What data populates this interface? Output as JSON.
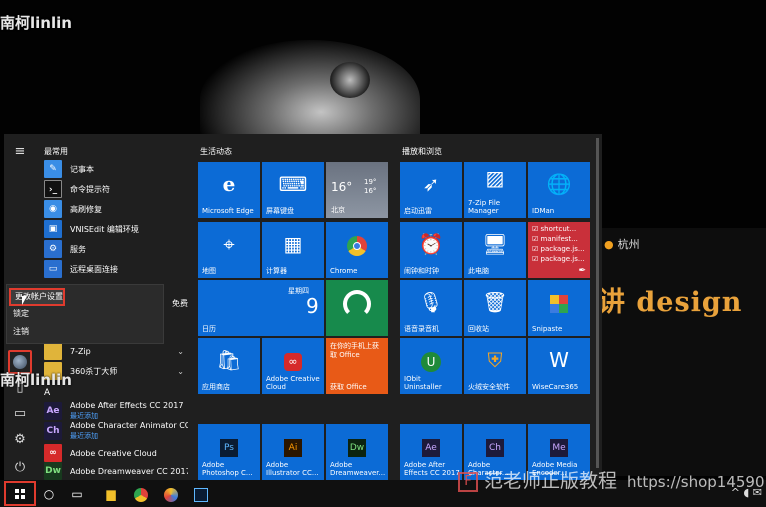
{
  "watermarks": {
    "top_left": "南柯linlin",
    "mid_left": "南柯linlin",
    "bottom_right": "范老师正版教程",
    "bottom_right_url": "https://shop14590"
  },
  "background_window": {
    "city": "杭州",
    "design_text": "讲 design"
  },
  "start_menu": {
    "section_recent": "最常用",
    "recent_apps": [
      {
        "name": "记事本"
      },
      {
        "name": "命令提示符"
      },
      {
        "name": "高刷修复"
      },
      {
        "name": "VNISEdit 编辑环境"
      },
      {
        "name": "服务"
      },
      {
        "name": "远程桌面连接"
      }
    ],
    "partial_text": "免费",
    "folders": [
      {
        "name": "7-Zip"
      },
      {
        "name": "360杀丁大师"
      }
    ],
    "letter_a": "A",
    "a_apps": [
      {
        "name": "Adobe After Effects CC 2017",
        "sub": "最近添加"
      },
      {
        "name": "Adobe Character Animator CC (...",
        "sub": "最近添加"
      },
      {
        "name": "Adobe Creative Cloud",
        "sub": ""
      },
      {
        "name": "Adobe Dreamweaver CC 2017",
        "sub": ""
      }
    ],
    "context_menu": {
      "change_account": "更改帐户设置",
      "lock": "锁定",
      "sign_out": "注销"
    },
    "groups": {
      "life": "生活动态",
      "play": "播放和浏览"
    },
    "weather": {
      "temp": "16°",
      "high": "19°",
      "low": "16°",
      "city": "北京"
    },
    "calendar": {
      "weekday": "星期四",
      "day": "9",
      "label": "日历"
    },
    "office_promo": {
      "text": "在你的手机上获取 Office",
      "label": "获取 Office"
    },
    "tiles_life": [
      {
        "label": "Microsoft Edge"
      },
      {
        "label": "屏幕键盘"
      },
      {
        "label": "地图"
      },
      {
        "label": "计算器"
      },
      {
        "label": "Chrome"
      },
      {
        "label": "应用商店"
      },
      {
        "label": "Adobe Creative Cloud"
      }
    ],
    "tiles_play": [
      {
        "label": "启动迅雷"
      },
      {
        "label": "7-Zip File Manager"
      },
      {
        "label": "IDMan"
      },
      {
        "label": "闹钟和时钟"
      },
      {
        "label": "此电脑"
      },
      {
        "label": "语音录音机"
      },
      {
        "label": "回收站"
      },
      {
        "label": "Snipaste"
      },
      {
        "label": "IObit Uninstaller"
      },
      {
        "label": "火绒安全软件"
      },
      {
        "label": "WiseCare365"
      }
    ],
    "shortcuts_tile": [
      "shortcut...",
      "manifest...",
      "package.js...",
      "package.js..."
    ],
    "tiles_bottom_life": [
      {
        "label": "Adobe Photoshop C...",
        "abbr": "Ps"
      },
      {
        "label": "Adobe Illustrator CC...",
        "abbr": "Ai"
      },
      {
        "label": "Adobe Dreamweaver...",
        "abbr": "Dw"
      }
    ],
    "tiles_bottom_play": [
      {
        "label": "Adobe After Effects CC 2017",
        "abbr": "Ae"
      },
      {
        "label": "Adobe Character...",
        "abbr": "Ch"
      },
      {
        "label": "Adobe Media Encoder...",
        "abbr": "Me"
      }
    ]
  },
  "colors": {
    "tile_blue": "#0c6bd6",
    "highlight_red": "#e03b2e",
    "shortcut_red": "#c9303a",
    "office_orange": "#e85a17",
    "green_tile": "#178a4c"
  }
}
